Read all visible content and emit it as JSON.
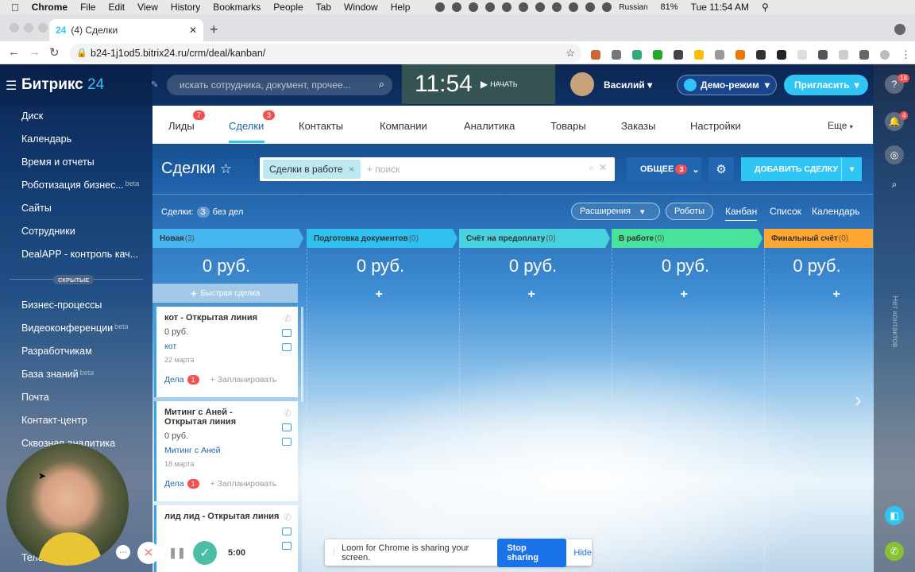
{
  "macos": {
    "apple": "",
    "app": "Chrome",
    "menus": [
      "File",
      "Edit",
      "View",
      "History",
      "Bookmarks",
      "People",
      "Tab",
      "Window",
      "Help"
    ],
    "lang": "Russian",
    "battery": "81%",
    "clock": "Tue 11:54 AM"
  },
  "chrome": {
    "tab_title": "(4) Сделки",
    "tab_favicon": "24",
    "url": "b24-1j1od5.bitrix24.ru/crm/deal/kanban/"
  },
  "header": {
    "logo_main": "Битрикс",
    "logo_num": "24",
    "search_placeholder": "искать сотрудника, документ, прочее...",
    "time": "11:54",
    "start_label": "НАЧАТЬ",
    "user": "Василий",
    "demo_label": "Демо-режим",
    "invite_label": "Пригласить"
  },
  "sidebar": {
    "items": [
      "Диск",
      "Календарь",
      "Время и отчеты",
      "Роботизация бизнес...",
      "Сайты",
      "Сотрудники",
      "DealAPP - контроль кач..."
    ],
    "hidden_label": "СКРЫТЫЕ",
    "hidden_items": [
      "Бизнес-процессы",
      "Видеоконференции",
      "Разработчикам",
      "База знаний",
      "Почта",
      "Контакт-центр",
      "Сквозная аналитика",
      "Теле..."
    ],
    "beta": "beta"
  },
  "right_panel": {
    "help_badge": "18",
    "notif_badge": "4",
    "no_contacts": "Нет контактов"
  },
  "crm_nav": {
    "items": [
      {
        "label": "Лиды",
        "badge": "7"
      },
      {
        "label": "Сделки",
        "badge": "3"
      },
      {
        "label": "Контакты"
      },
      {
        "label": "Компании"
      },
      {
        "label": "Аналитика"
      },
      {
        "label": "Товары"
      },
      {
        "label": "Заказы"
      },
      {
        "label": "Настройки"
      }
    ],
    "more": "Еще"
  },
  "toolbar": {
    "title": "Сделки",
    "filter_tag": "Сделки в работе",
    "search_placeholder": "+ поиск",
    "general_label": "ОБЩЕЕ",
    "general_badge": "3",
    "add_label": "ДОБАВИТЬ СДЕЛКУ"
  },
  "subbar": {
    "deals_label": "Сделки:",
    "deals_count": "3",
    "no_tasks": "без дел",
    "extensions": "Расширения",
    "robots": "Роботы",
    "views": [
      "Канбан",
      "Список",
      "Календарь"
    ]
  },
  "kanban": {
    "columns": [
      {
        "name": "Новая",
        "count": "(3)",
        "sum": "0 руб.",
        "color": "#46b6f0"
      },
      {
        "name": "Подготовка документов",
        "count": "(0)",
        "sum": "0 руб.",
        "color": "#2ec1f0"
      },
      {
        "name": "Счёт на предоплату",
        "count": "(0)",
        "sum": "0 руб.",
        "color": "#48d2e0"
      },
      {
        "name": "В работе",
        "count": "(0)",
        "sum": "0 руб.",
        "color": "#47e39a"
      },
      {
        "name": "Финальный счёт",
        "count": "(0)",
        "sum": "0 руб.",
        "color": "#ffa631"
      }
    ],
    "quick_deal": "Быстрая сделка",
    "cards": [
      {
        "title": "кот - Открытая линия",
        "sum": "0 руб.",
        "link": "кот",
        "date": "22 марта",
        "tasks": "Дела",
        "tasks_badge": "1",
        "plan": "+ Запланировать"
      },
      {
        "title": "Митинг с Аней - Открытая линия",
        "sum": "0 руб.",
        "link": "Митинг с Аней",
        "date": "18 марта",
        "tasks": "Дела",
        "tasks_badge": "1",
        "plan": "+ Запланировать"
      },
      {
        "title": "лид лид - Открытая линия",
        "sum": "",
        "link": "",
        "date": "",
        "tasks": "",
        "tasks_badge": "",
        "plan": ""
      }
    ]
  },
  "loom": {
    "message": "Loom for Chrome is sharing your screen.",
    "stop": "Stop sharing",
    "hide": "Hide",
    "timer": "5:00"
  }
}
